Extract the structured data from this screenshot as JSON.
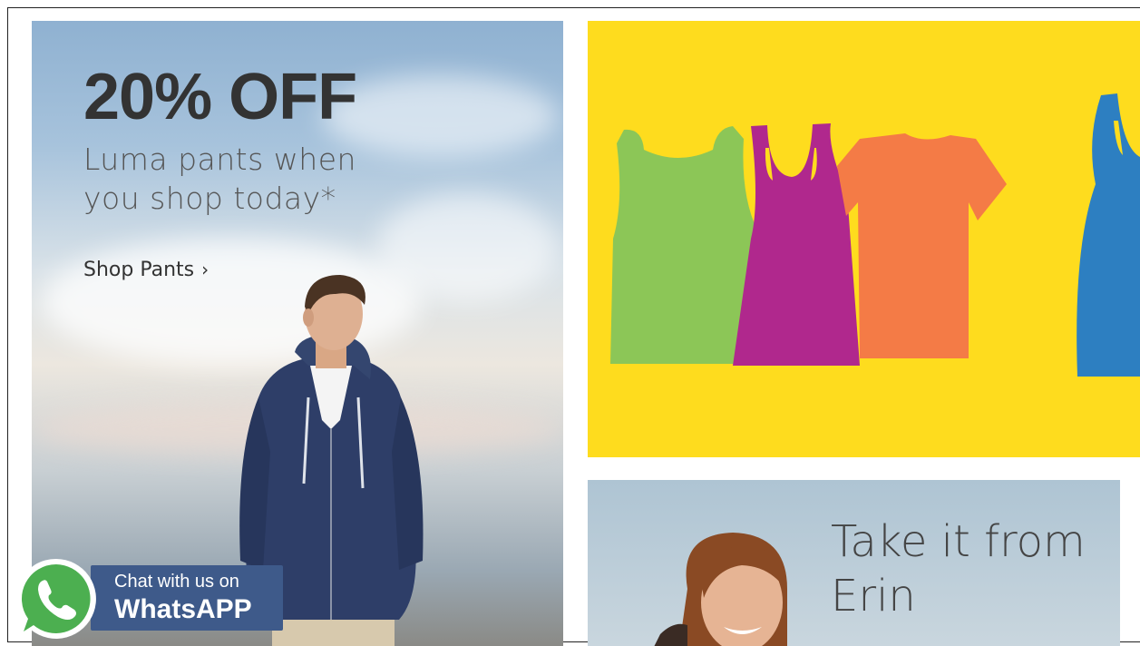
{
  "pants_promo": {
    "headline": "20% OFF",
    "subtext_line1": "Luma pants when",
    "subtext_line2": "you shop today*",
    "cta": "Shop Pants",
    "cta_chevron": "›"
  },
  "tees_promo": {
    "colors": {
      "background": "#fedc1e",
      "green": "#8cc657",
      "magenta": "#b0288d",
      "orange": "#f47b46",
      "blue": "#2d7fc1"
    }
  },
  "erin_promo": {
    "title_line1": "Take it from",
    "title_line2": "Erin"
  },
  "whatsapp": {
    "line1": "Chat with us on",
    "line2": "WhatsAPP",
    "icon": "whatsapp-icon",
    "colors": {
      "brand": "#4caf50",
      "box": "#3e5a8a"
    }
  }
}
